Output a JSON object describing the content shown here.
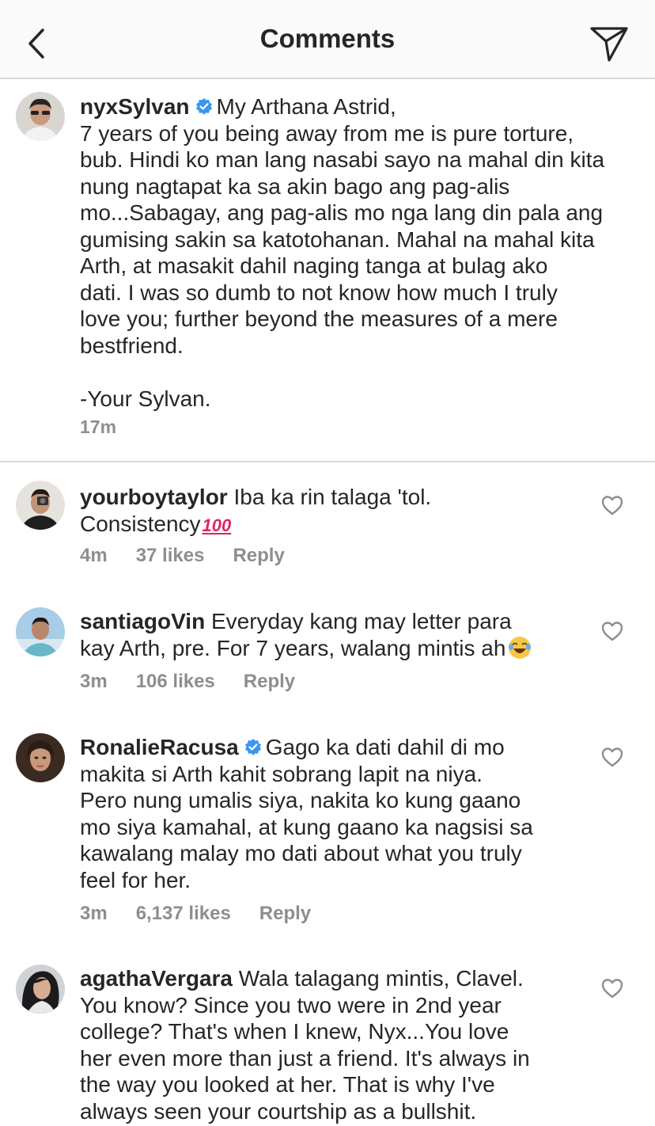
{
  "header": {
    "title": "Comments"
  },
  "caption": {
    "username": "nyxSylvan",
    "verified": true,
    "lines": [
      "My Arthana Astrid,",
      "7 years of you being away from me is pure torture,",
      "bub. Hindi ko man lang nasabi sayo na mahal din kita",
      "nung nagtapat ka sa akin bago ang pag-alis",
      "mo...Sabagay, ang pag-alis mo nga lang din pala ang",
      "gumising sakin sa katotohanan. Mahal na mahal kita",
      "Arth, at masakit dahil naging tanga at bulag ako",
      "dati. I was so dumb to not know how much I truly",
      "love you; further beyond the measures of a mere",
      "bestfriend."
    ],
    "signature": "-Your Sylvan.",
    "time": "17m"
  },
  "comments": [
    {
      "username": "yourboytaylor",
      "verified": false,
      "lines": [
        "Iba ka rin talaga 'tol.",
        "Consistency"
      ],
      "emoji": "💯",
      "time": "4m",
      "likes": "37 likes",
      "reply": "Reply"
    },
    {
      "username": "santiagoVin",
      "verified": false,
      "lines": [
        "Everyday kang may letter para",
        "kay Arth, pre. For 7 years, walang mintis ah"
      ],
      "emoji": "😂",
      "time": "3m",
      "likes": "106 likes",
      "reply": "Reply"
    },
    {
      "username": "RonalieRacusa",
      "verified": true,
      "lines": [
        "Gago ka dati dahil di mo",
        "makita si Arth kahit sobrang lapit na niya.",
        "Pero nung umalis siya, nakita ko kung gaano",
        "mo siya kamahal, at kung gaano ka nagsisi sa",
        "kawalang malay mo dati about what you truly",
        "feel for her."
      ],
      "time": "3m",
      "likes": "6,137 likes",
      "reply": "Reply"
    },
    {
      "username": "agathaVergara",
      "verified": false,
      "lines": [
        "Wala talagang mintis, Clavel.",
        "You know? Since you two were in 2nd year",
        "college? That's when I knew, Nyx...You love",
        "her even more than just a friend. It's always in",
        "the way you looked at her. That is why I've",
        "always seen your courtship as a bullshit."
      ]
    }
  ],
  "colors": {
    "verified": "#3897f0",
    "meta": "#8e8e8e",
    "text": "#262626",
    "divider": "#dbdbdb"
  },
  "icons": [
    "back-arrow-icon",
    "send-icon",
    "verified-badge-icon",
    "heart-icon",
    "hundred-points-emoji",
    "laughing-emoji"
  ]
}
